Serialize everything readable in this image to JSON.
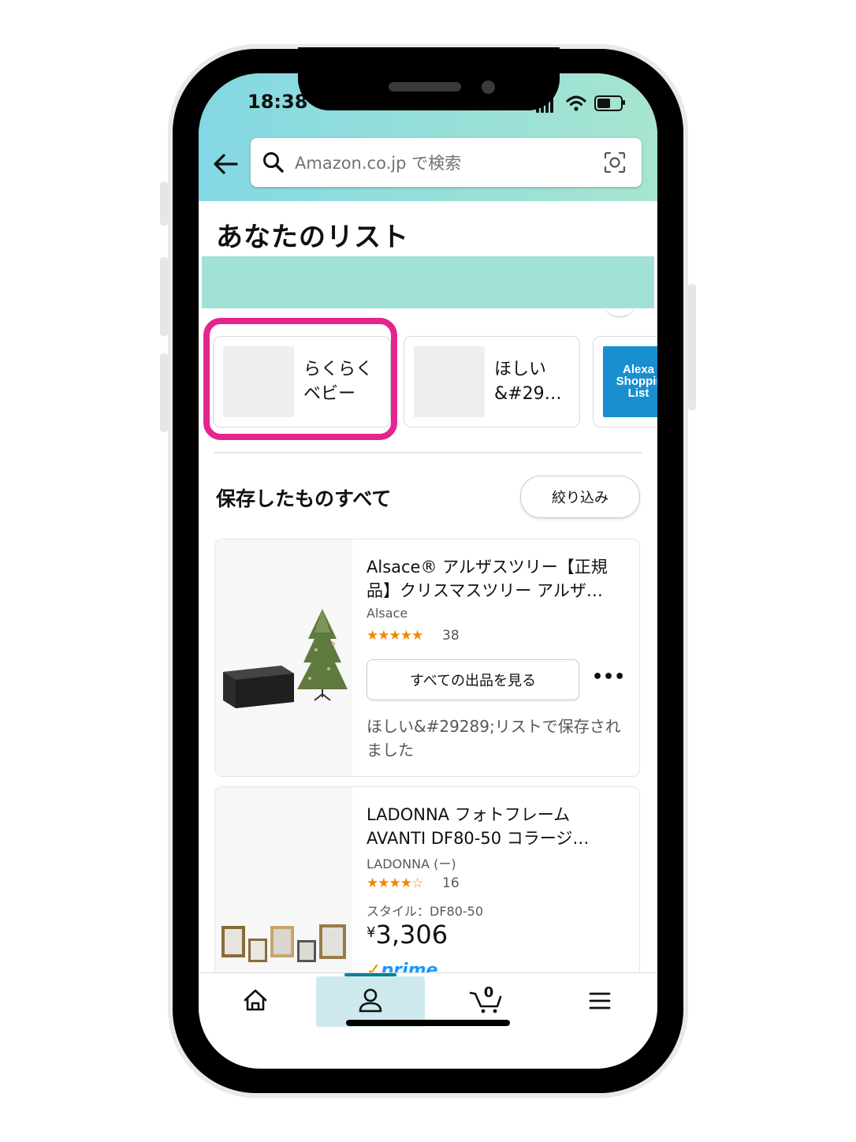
{
  "status_bar": {
    "time": "18:38"
  },
  "search": {
    "placeholder": "Amazon.co.jp で検索"
  },
  "page": {
    "title": "あなたのリスト"
  },
  "lists": [
    {
      "label": "らくらく\nベビー"
    },
    {
      "label": "ほしい\n&#29…"
    },
    {
      "label": "Alexa Shopping List",
      "thumb_lines": [
        "Alexa",
        "Shoppir",
        "List"
      ]
    }
  ],
  "saved_section": {
    "title": "保存したものすべて",
    "filter_label": "絞り込み"
  },
  "products": [
    {
      "title": "Alsace® アルザスツリー【正規品】クリスマスツリー アルザ…",
      "brand": "Alsace",
      "stars": "★★★★★",
      "rating": 5,
      "review_count": "38",
      "see_all_label": "すべての出品を見る",
      "more_label": "•••",
      "saved_note": "ほしい&#29289;リストで保存されました"
    },
    {
      "title": "LADONNA フォトフレーム AVANTI DF80-50 コラージ…",
      "brand": "LADONNA (ー)",
      "stars": "★★★★☆",
      "rating": 4.5,
      "review_count": "16",
      "style": "スタイル：DF80-50",
      "currency": "¥",
      "price": "3,306",
      "prime_label": "prime"
    }
  ],
  "bottom_nav": {
    "items": [
      "home-icon",
      "account-icon",
      "cart-icon",
      "menu-icon"
    ],
    "cart_count": "0",
    "active": "account"
  },
  "colors": {
    "header_gradient_start": "#84d8e3",
    "header_gradient_end": "#a6e5d0",
    "highlight": "#e5258f",
    "star": "#f08804",
    "nav_active": "#cde9ee",
    "nav_active_bar": "#008296",
    "alexa_blue": "#1a8fd0",
    "prime_blue": "#1a98ff"
  }
}
